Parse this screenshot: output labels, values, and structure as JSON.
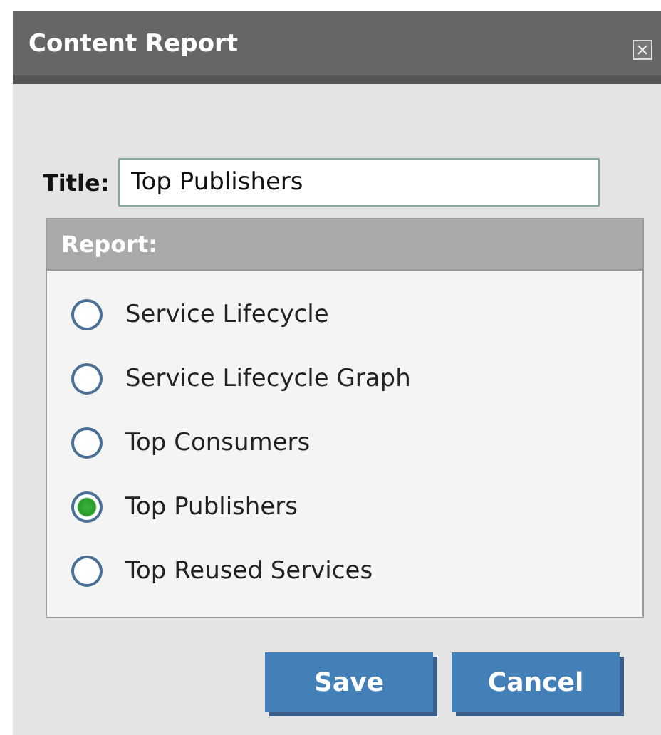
{
  "window": {
    "title": "Content Report"
  },
  "title_field": {
    "label": "Title:",
    "value": "Top Publishers"
  },
  "report": {
    "heading": "Report:",
    "options": [
      {
        "label": "Service Lifecycle",
        "selected": false
      },
      {
        "label": "Service Lifecycle Graph",
        "selected": false
      },
      {
        "label": "Top Consumers",
        "selected": false
      },
      {
        "label": "Top Publishers",
        "selected": true
      },
      {
        "label": "Top Reused Services",
        "selected": false
      }
    ]
  },
  "buttons": [
    "Save",
    "Cancel"
  ]
}
